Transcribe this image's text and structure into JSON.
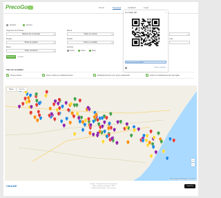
{
  "app": {
    "logo_text": "PrecoGo",
    "brand_color": "#5cae3c",
    "nav": [
      "Home",
      "Pesquisa",
      "Cadastro",
      "Login"
    ],
    "nav_active_index": 1
  },
  "filters": {
    "mode_options": [
      "Produto",
      "Serviço"
    ],
    "mode_selected": "Produto",
    "fields": [
      {
        "label": "Segmento de Produto",
        "value": "Material de construção"
      },
      {
        "label": "Marca",
        "value": "Todas as marcas"
      },
      {
        "label": "Modelo",
        "value": ""
      },
      {
        "label": "Região",
        "value": "Todas as regiões"
      },
      {
        "label": "Estado",
        "value": "Todos os estados"
      },
      {
        "label": "Cidade",
        "value": ""
      },
      {
        "label": "Bairro",
        "value": "Todos os bairros"
      },
      {
        "label": "Loja",
        "value": ""
      }
    ],
    "period_label": "Período",
    "period_value": "Últimos 30 dias",
    "sort_options": [
      "Todos",
      "Preço",
      "Data"
    ],
    "search_button": "Pesquisar",
    "clear_button": "Limpar"
  },
  "result_types": {
    "title": "Tipo de resultado",
    "items": [
      "Preço pontual",
      "Preço médio por estabelecimento",
      "Estabelecimentos com preço cadastrado",
      "Todos os estabelecimentos da região"
    ]
  },
  "qr_popup": {
    "title": "Ler código QR",
    "link_text": "https://precogo.app/m/88421",
    "close_label": "Fechar",
    "footer_link": "Baixar o aplicativo"
  },
  "map": {
    "tabs": [
      "Mapa",
      "Satélite"
    ],
    "zoom_in": "+",
    "zoom_out": "−",
    "attribution": "Dados cartográficos ©2023 Google · Termos de Uso",
    "land_color": "#f2efe6",
    "sea_color": "#aadaff",
    "marker_colors": [
      "#e53935",
      "#1e88e5",
      "#43a047",
      "#fdd835",
      "#8e24aa",
      "#fb8c00"
    ]
  },
  "footer": {
    "left_logo": "CIDADE",
    "lines": [
      "Precogo - Pesquisa de preços em tempo real",
      "Todos os direitos reservados © 2023",
      "Política de privacidade · Termos de uso"
    ],
    "right_badge": "Google Play"
  }
}
